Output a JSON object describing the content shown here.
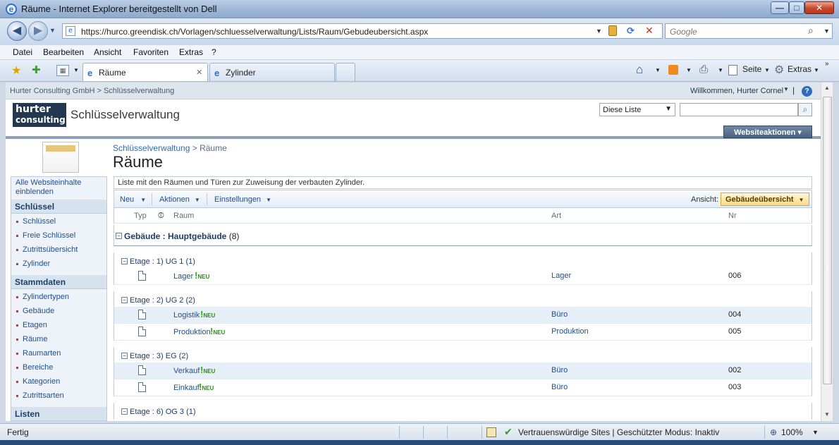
{
  "window": {
    "title": "Räume - Internet Explorer bereitgestellt von Dell",
    "minimize": "—",
    "maximize": "□",
    "close": "✕"
  },
  "browser": {
    "back": "◀",
    "forward": "▶",
    "url": "https://hurco.greendisk.ch/Vorlagen/schluesselverwaltung/Lists/Raum/Gebudeubersicht.aspx",
    "search_placeholder": "Google",
    "menu": [
      "Datei",
      "Bearbeiten",
      "Ansicht",
      "Favoriten",
      "Extras",
      "?"
    ],
    "tabs": [
      {
        "label": "Räume",
        "active": true
      },
      {
        "label": "Zylinder",
        "active": false
      }
    ],
    "tab_close": "✕",
    "tools": {
      "page": "Seite",
      "extras": "Extras"
    }
  },
  "sharepoint": {
    "breadcrumb_top": "Hurter Consulting GmbH > Schlüsselverwaltung",
    "welcome": "Willkommen, Hurter Cornel",
    "help": "?",
    "logo_line1": "hurter",
    "logo_line2": "consulting",
    "site_title": "Schlüsselverwaltung",
    "search_scope": "Diese Liste",
    "site_actions": "Websiteaktionen",
    "crumb_parent": "Schlüsselverwaltung",
    "crumb_sep": " > ",
    "crumb_current": "Räume",
    "page_title": "Räume",
    "list_description": "Liste mit den Räumen und Türen zur Zuweisung der verbauten Zylinder.",
    "toolbar": {
      "new": "Neu",
      "actions": "Aktionen",
      "settings": "Einstellungen",
      "view_label": "Ansicht:",
      "view_value": "Gebäudeübersicht"
    },
    "columns": {
      "type": "Typ",
      "room": "Raum",
      "art": "Art",
      "nr": "Nr"
    },
    "quicklaunch": {
      "all_content": "Alle Websiteinhalte einblenden",
      "section1": "Schlüssel",
      "section1_items": [
        "Schlüssel",
        "Freie Schlüssel",
        "Zutrittsübersicht",
        "Zylinder"
      ],
      "section2": "Stammdaten",
      "section2_items": [
        "Zylindertypen",
        "Gebäude",
        "Etagen",
        "Räume",
        "Raumarten",
        "Bereiche",
        "Kategorien",
        "Zutrittsarten"
      ],
      "section3": "Listen"
    },
    "group": {
      "label": "Gebäude : Hauptgebäude",
      "count": "(8)"
    },
    "subgroups": [
      {
        "label": "Etage : 1) UG 1",
        "count": "(1)"
      },
      {
        "label": "Etage : 2) UG 2",
        "count": "(2)"
      },
      {
        "label": "Etage : 3) EG",
        "count": "(2)"
      },
      {
        "label": "Etage : 6) OG 3",
        "count": "(1)"
      }
    ],
    "rows": [
      {
        "raum": "Lager",
        "art": "Lager",
        "nr": "006"
      },
      {
        "raum": "Logistik",
        "art": "Büro",
        "nr": "004"
      },
      {
        "raum": "Produktion",
        "art": "Produktion",
        "nr": "005"
      },
      {
        "raum": "Verkauf",
        "art": "Büro",
        "nr": "002"
      },
      {
        "raum": "Einkauf",
        "art": "Büro",
        "nr": "003"
      }
    ],
    "new_badge": "NEU"
  },
  "status": {
    "left": "Fertig",
    "zone": "Vertrauenswürdige Sites | Geschützter Modus: Inaktiv",
    "zoom": "100%"
  }
}
